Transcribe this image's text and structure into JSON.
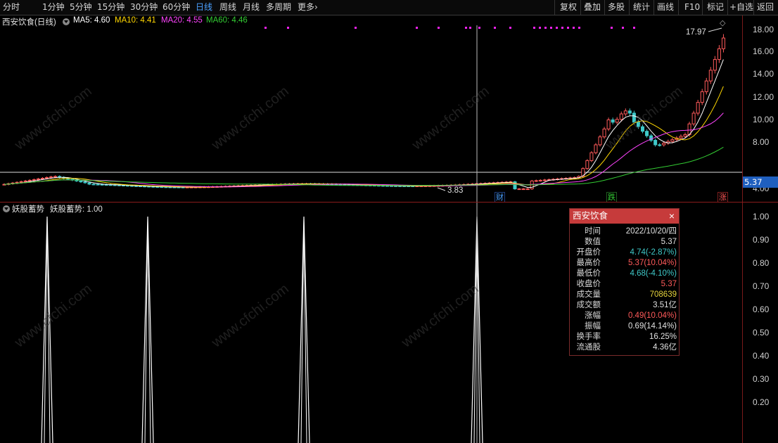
{
  "toolbar": {
    "periods": [
      {
        "label": "分时",
        "active": false
      },
      {
        "label": "1分钟",
        "active": false
      },
      {
        "label": "5分钟",
        "active": false
      },
      {
        "label": "15分钟",
        "active": false
      },
      {
        "label": "30分钟",
        "active": false
      },
      {
        "label": "60分钟",
        "active": false
      },
      {
        "label": "日线",
        "active": true
      },
      {
        "label": "周线",
        "active": false
      },
      {
        "label": "月线",
        "active": false
      },
      {
        "label": "多周期",
        "active": false
      },
      {
        "label": "更多",
        "active": false
      }
    ],
    "more_arrow": "›",
    "actions": [
      "复权",
      "叠加",
      "多股",
      "统计",
      "画线",
      "F10",
      "标记",
      "+自选",
      "返回"
    ]
  },
  "main_panel": {
    "title": "西安饮食(日线)",
    "ma_legend": [
      {
        "label": "MA5: 4.60",
        "color": "#ffffff"
      },
      {
        "label": "MA10: 4.41",
        "color": "#ffd700"
      },
      {
        "label": "MA20: 4.55",
        "color": "#ff44ff"
      },
      {
        "label": "MA60: 4.46",
        "color": "#33cc33"
      }
    ],
    "y_axis": [
      "18.00",
      "16.00",
      "14.00",
      "12.00",
      "10.00",
      "8.00",
      "4.00"
    ],
    "current_price_tag": "5.37",
    "high_label": "17.97",
    "low_label": "3.83",
    "events": [
      {
        "label": "财",
        "color": "#4aa0ff"
      },
      {
        "label": "跌",
        "color": "#33cc33"
      },
      {
        "label": "涨",
        "color": "#ff5555"
      }
    ]
  },
  "sub_panel": {
    "title": "妖股蓄势",
    "value_label": "妖股蓄势: 1.00",
    "y_axis": [
      "1.00",
      "0.90",
      "0.80",
      "0.70",
      "0.60",
      "0.50",
      "0.40",
      "0.30",
      "0.20"
    ]
  },
  "info_box": {
    "title": "西安饮食",
    "close": "×",
    "rows": [
      {
        "label": "时间",
        "value": "2022/10/20/四",
        "color": "#e0e0e0"
      },
      {
        "label": "数值",
        "value": "5.37",
        "color": "#e0e0e0"
      },
      {
        "label": "开盘价",
        "value": "4.74(-2.87%)",
        "color": "#3fc9c9"
      },
      {
        "label": "最高价",
        "value": "5.37(10.04%)",
        "color": "#ff5a5a"
      },
      {
        "label": "最低价",
        "value": "4.68(-4.10%)",
        "color": "#3fc9c9"
      },
      {
        "label": "收盘价",
        "value": "5.37",
        "color": "#ff5a5a"
      },
      {
        "label": "成交量",
        "value": "708639",
        "color": "#e6d33c"
      },
      {
        "label": "成交额",
        "value": "3.51亿",
        "color": "#e0e0e0"
      },
      {
        "label": "涨幅",
        "value": "0.49(10.04%)",
        "color": "#ff5a5a"
      },
      {
        "label": "振幅",
        "value": "0.69(14.14%)",
        "color": "#e0e0e0"
      },
      {
        "label": "换手率",
        "value": "16.25%",
        "color": "#e0e0e0"
      },
      {
        "label": "流通股",
        "value": "4.36亿",
        "color": "#e0e0e0"
      }
    ]
  },
  "watermark": "www.cfchi.com"
}
